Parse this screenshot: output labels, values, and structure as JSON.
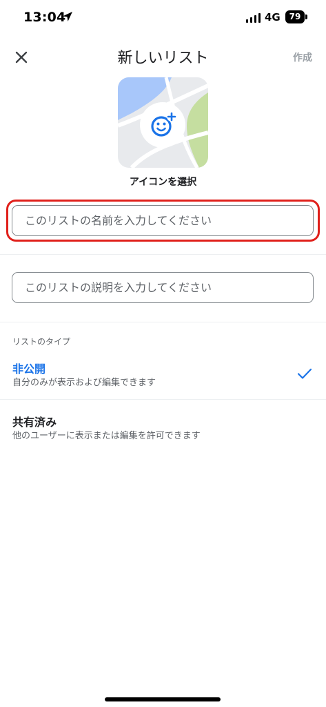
{
  "status_bar": {
    "time": "13:04",
    "network": "4G",
    "battery": "79"
  },
  "header": {
    "title": "新しいリスト",
    "create_label": "作成"
  },
  "icon_picker": {
    "label": "アイコンを選択"
  },
  "form": {
    "name_placeholder": "このリストの名前を入力してください",
    "description_placeholder": "このリストの説明を入力してください"
  },
  "list_type": {
    "section_label": "リストのタイプ",
    "options": [
      {
        "title": "非公開",
        "subtitle": "自分のみが表示および編集できます",
        "selected": true
      },
      {
        "title": "共有済み",
        "subtitle": "他のユーザーに表示または編集を許可できます",
        "selected": false
      }
    ]
  },
  "colors": {
    "accent": "#1a73e8",
    "highlight": "#e0201b",
    "map_water": "#a8c7fa",
    "map_park": "#c5dea0",
    "map_land": "#e8eaed"
  }
}
